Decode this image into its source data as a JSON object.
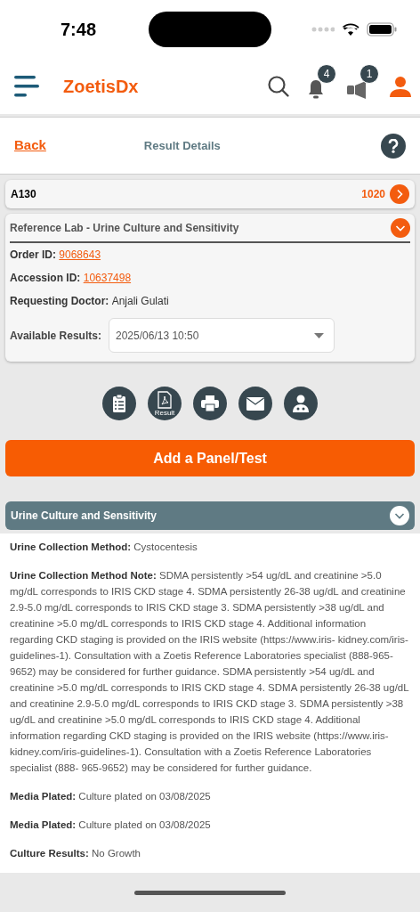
{
  "status_bar": {
    "time": "7:48"
  },
  "header": {
    "logo": "ZoetisDx",
    "notifications": {
      "count": "4"
    },
    "announcements": {
      "count": "1"
    }
  },
  "nav": {
    "back": "Back",
    "title": "Result Details"
  },
  "patient_card": {
    "id": "A130",
    "number": "1020"
  },
  "order_card": {
    "title": "Reference Lab - Urine Culture and Sensitivity",
    "expanded": true,
    "fields": [
      {
        "label": "Order ID:",
        "value": "9068643",
        "kind": "link"
      },
      {
        "label": "Accession ID:",
        "value": "10637498",
        "kind": "link"
      },
      {
        "label": "Requesting Doctor:",
        "value": "Anjali Gulati",
        "kind": "text"
      }
    ],
    "available_results": {
      "label": "Available Results:",
      "value": "2025/06/13 10:50"
    }
  },
  "actions": [
    {
      "kind": "clipboard"
    },
    {
      "kind": "pdf",
      "label": "Result"
    },
    {
      "kind": "print"
    },
    {
      "kind": "email"
    },
    {
      "kind": "doctor"
    }
  ],
  "add_button": "Add a Panel/Test",
  "section": {
    "title": "Urine Culture and Sensitivity",
    "expanded": true,
    "paragraphs": [
      "**Urine Collection Method:** Cystocentesis",
      "**Urine Collection Method Note:** SDMA persistently >54 ug/dL and creatinine >5.0 mg/dL corresponds to IRIS CKD stage 4. SDMA persistently 26-38 ug/dL and creatinine 2.9-5.0 mg/dL corresponds to IRIS CKD stage 3. SDMA persistently >38 ug/dL and creatinine >5.0 mg/dL corresponds to IRIS CKD stage 4. Additional information regarding CKD staging is provided on the IRIS website (https://www.iris- kidney.com/iris-guidelines-1).  Consultation with a Zoetis Reference Laboratories specialist (888-965-9652) may be considered for further guidance.  SDMA persistently >54 ug/dL and creatinine >5.0 mg/dL corresponds to IRIS CKD stage 4. SDMA persistently 26-38 ug/dL and creatinine 2.9-5.0 mg/dL corresponds to IRIS CKD stage 3. SDMA persistently >38 ug/dL and creatinine >5.0 mg/dL corresponds to IRIS CKD stage 4. Additional information regarding CKD staging is provided on the IRIS website (https://www.iris-kidney.com/iris-guidelines-1).  Consultation with a Zoetis Reference Laboratories specialist (888- 965-9652) may be considered for further guidance.",
      "**Media Plated:** Culture plated on 03/08/2025",
      "**Media Plated:** Culture plated on 03/08/2025",
      "**Culture Results:** No Growth"
    ]
  }
}
